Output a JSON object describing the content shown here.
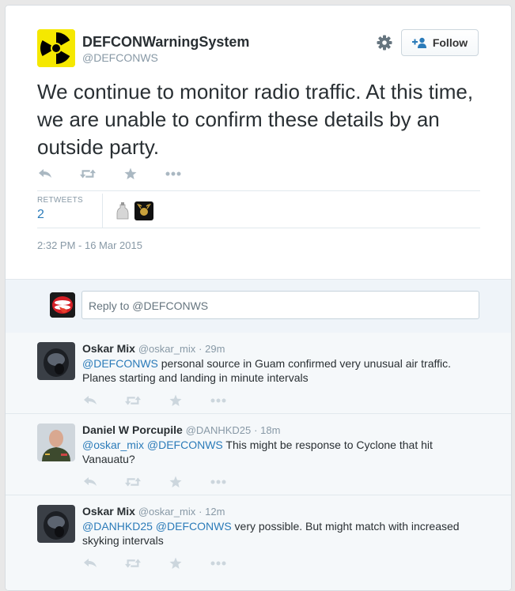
{
  "tweet": {
    "name": "DEFCONWarningSystem",
    "handle": "@DEFCONWS",
    "follow_label": "Follow",
    "text": "We continue to monitor radio traffic. At this time, we are unable to confirm these details by an outside party.",
    "retweets_label": "RETWEETS",
    "retweets_count": "2",
    "timestamp": "2:32 PM - 16 Mar 2015",
    "icons": {
      "settings": "gear-icon",
      "follow": "person-add-icon",
      "avatar": "radiation-symbol"
    }
  },
  "reply_box": {
    "placeholder": "Reply to @DEFCONWS"
  },
  "replies": [
    {
      "name": "Oskar Mix",
      "handle": "@oskar_mix",
      "time": "29m",
      "mentions": "@DEFCONWS",
      "text": " personal source in Guam confirmed very unusual air traffic. Planes starting and landing in minute intervals"
    },
    {
      "name": "Daniel W Porcupile",
      "handle": "@DANHKD25",
      "time": "18m",
      "mentions": "@oskar_mix @DEFCONWS",
      "text": " This might be response to Cyclone that hit Vanauatu?"
    },
    {
      "name": "Oskar Mix",
      "handle": "@oskar_mix",
      "time": "12m",
      "mentions": "@DANHKD25 @DEFCONWS",
      "text": " very possible. But might match with increased skyking intervals"
    }
  ],
  "colors": {
    "link": "#2b7bb9",
    "meta": "#8899a6",
    "reply_bg": "#f5f8fa",
    "reply_zone_bg": "#eff4f9"
  }
}
